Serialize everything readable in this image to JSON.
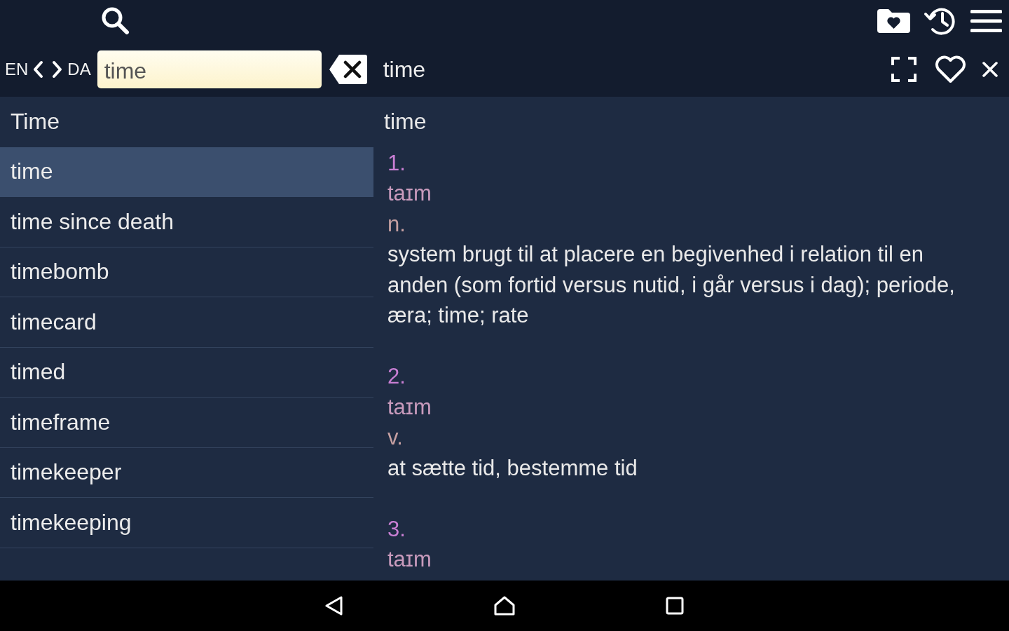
{
  "toolbar": {
    "language_from": "EN",
    "language_to": "DA",
    "search": {
      "value": "time"
    },
    "title": "time",
    "favorite": false
  },
  "word_list": [
    {
      "label": "Time",
      "selected": false
    },
    {
      "label": "time",
      "selected": true
    },
    {
      "label": "time since death",
      "selected": false
    },
    {
      "label": "timebomb",
      "selected": false
    },
    {
      "label": "timecard",
      "selected": false
    },
    {
      "label": "timed",
      "selected": false
    },
    {
      "label": "timeframe",
      "selected": false
    },
    {
      "label": "timekeeper",
      "selected": false
    },
    {
      "label": "timekeeping",
      "selected": false
    }
  ],
  "entry": {
    "headword": "time",
    "senses": [
      {
        "number": "1.",
        "pronunciation": "taɪm",
        "part_of_speech": "n.",
        "definition": "system brugt til at placere en begivenhed i relation til en anden (som fortid versus nutid, i går versus i dag); periode, æra; time; rate"
      },
      {
        "number": "2.",
        "pronunciation": "taɪm",
        "part_of_speech": "v.",
        "definition": "at sætte tid, bestemme tid"
      },
      {
        "number": "3.",
        "pronunciation": "taɪm"
      }
    ]
  }
}
